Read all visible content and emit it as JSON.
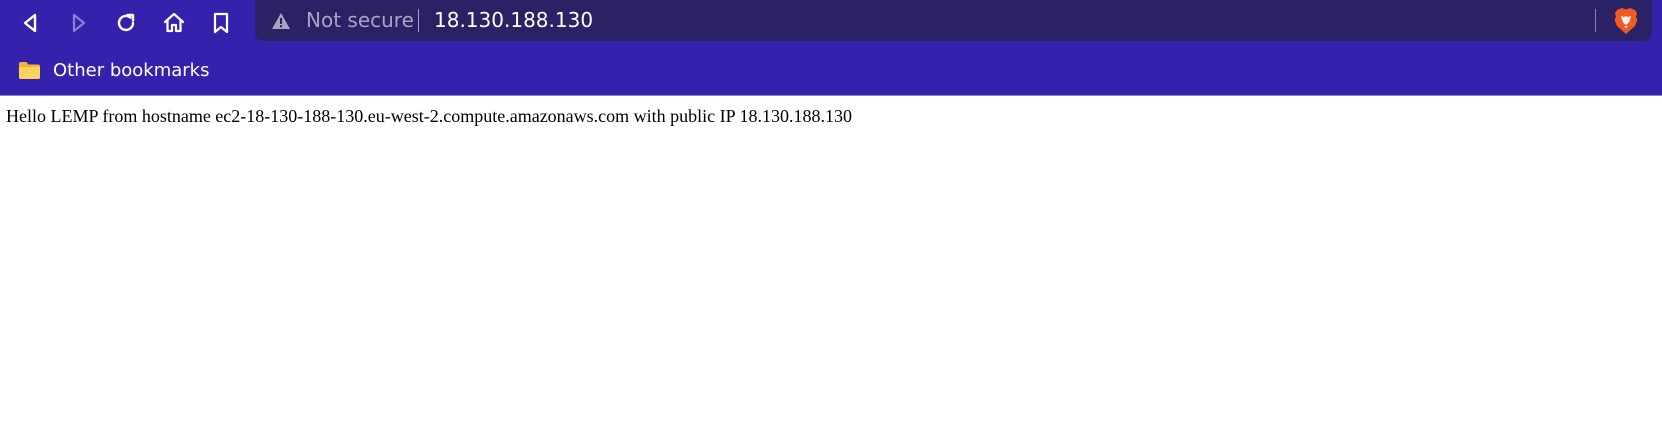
{
  "address_bar": {
    "security_label": "Not secure",
    "url": "18.130.188.130"
  },
  "toolbar": {
    "icons": [
      "back-icon",
      "forward-icon",
      "reload-icon",
      "home-icon",
      "bookmark-icon"
    ]
  },
  "bookmarks_bar": {
    "items": [
      {
        "label": "Other bookmarks",
        "icon": "folder-icon"
      }
    ]
  },
  "page": {
    "body_text": "Hello LEMP from hostname ec2-18-130-188-130.eu-west-2.compute.amazonaws.com with public IP 18.130.188.130"
  },
  "colors": {
    "toolbar_bg": "#3422ac",
    "urlbar_bg": "#2a2264",
    "brave_orange": "#f15a22"
  }
}
